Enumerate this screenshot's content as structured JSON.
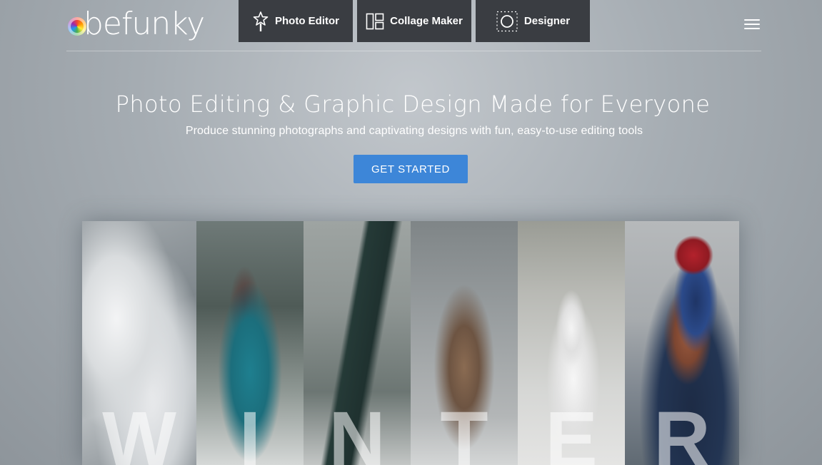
{
  "header": {
    "logo_text": "befunky",
    "nav": [
      {
        "label": "Photo Editor",
        "icon": "star-wand-icon"
      },
      {
        "label": "Collage Maker",
        "icon": "collage-grid-icon"
      },
      {
        "label": "Designer",
        "icon": "design-circle-icon"
      }
    ],
    "menu_icon": "hamburger-menu-icon"
  },
  "hero": {
    "title": "Photo Editing & Graphic Design Made for Everyone",
    "subtitle": "Produce stunning photographs and captivating designs with fun, easy-to-use editing tools",
    "cta_label": "GET STARTED"
  },
  "panels": {
    "letters": [
      "W",
      "I",
      "N",
      "T",
      "E",
      "R"
    ]
  },
  "colors": {
    "cta": "#3d86d8",
    "nav_button": "#3a3d42",
    "text": "#ffffff"
  }
}
